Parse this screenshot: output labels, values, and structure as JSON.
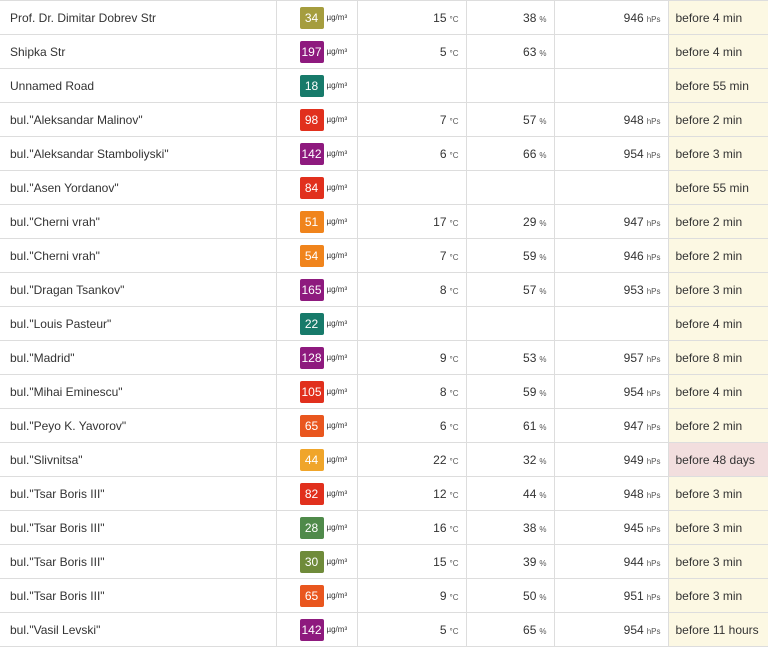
{
  "table": {
    "rows": [
      {
        "location": "Prof. Dr. Dimitar Dobrev Str",
        "aqi": "34",
        "color": "#a59d3e",
        "pm_unit": "µg/m³",
        "temp": "15",
        "temp_unit": "°C",
        "humidity": "38",
        "humidity_unit": "%",
        "pressure": "946",
        "pressure_unit": "hPs",
        "updated": "before 4 min",
        "stale": false
      },
      {
        "location": "Shipka Str",
        "aqi": "197",
        "color": "#8e1a7e",
        "pm_unit": "µg/m³",
        "temp": "5",
        "temp_unit": "°C",
        "humidity": "63",
        "humidity_unit": "%",
        "pressure": "",
        "pressure_unit": "",
        "updated": "before 4 min",
        "stale": false
      },
      {
        "location": "Unnamed Road",
        "aqi": "18",
        "color": "#177a6a",
        "pm_unit": "µg/m³",
        "temp": "",
        "temp_unit": "",
        "humidity": "",
        "humidity_unit": "",
        "pressure": "",
        "pressure_unit": "",
        "updated": "before 55 min",
        "stale": false
      },
      {
        "location": "bul.\"Aleksandar Malinov\"",
        "aqi": "98",
        "color": "#e1301d",
        "pm_unit": "µg/m³",
        "temp": "7",
        "temp_unit": "°C",
        "humidity": "57",
        "humidity_unit": "%",
        "pressure": "948",
        "pressure_unit": "hPs",
        "updated": "before 2 min",
        "stale": false
      },
      {
        "location": "bul.\"Aleksandar Stamboliyski\"",
        "aqi": "142",
        "color": "#8e1a7e",
        "pm_unit": "µg/m³",
        "temp": "6",
        "temp_unit": "°C",
        "humidity": "66",
        "humidity_unit": "%",
        "pressure": "954",
        "pressure_unit": "hPs",
        "updated": "before 3 min",
        "stale": false
      },
      {
        "location": "bul.\"Asen Yordanov\"",
        "aqi": "84",
        "color": "#e1301d",
        "pm_unit": "µg/m³",
        "temp": "",
        "temp_unit": "",
        "humidity": "",
        "humidity_unit": "",
        "pressure": "",
        "pressure_unit": "",
        "updated": "before 55 min",
        "stale": false
      },
      {
        "location": "bul.\"Cherni vrah\"",
        "aqi": "51",
        "color": "#f0841c",
        "pm_unit": "µg/m³",
        "temp": "17",
        "temp_unit": "°C",
        "humidity": "29",
        "humidity_unit": "%",
        "pressure": "947",
        "pressure_unit": "hPs",
        "updated": "before 2 min",
        "stale": false
      },
      {
        "location": "bul.\"Cherni vrah\"",
        "aqi": "54",
        "color": "#f0841c",
        "pm_unit": "µg/m³",
        "temp": "7",
        "temp_unit": "°C",
        "humidity": "59",
        "humidity_unit": "%",
        "pressure": "946",
        "pressure_unit": "hPs",
        "updated": "before 2 min",
        "stale": false
      },
      {
        "location": "bul.\"Dragan Tsankov\"",
        "aqi": "165",
        "color": "#8e1a7e",
        "pm_unit": "µg/m³",
        "temp": "8",
        "temp_unit": "°C",
        "humidity": "57",
        "humidity_unit": "%",
        "pressure": "953",
        "pressure_unit": "hPs",
        "updated": "before 3 min",
        "stale": false
      },
      {
        "location": "bul.\"Louis Pasteur\"",
        "aqi": "22",
        "color": "#177a6a",
        "pm_unit": "µg/m³",
        "temp": "",
        "temp_unit": "",
        "humidity": "",
        "humidity_unit": "",
        "pressure": "",
        "pressure_unit": "",
        "updated": "before 4 min",
        "stale": false
      },
      {
        "location": "bul.\"Madrid\"",
        "aqi": "128",
        "color": "#8e1a7e",
        "pm_unit": "µg/m³",
        "temp": "9",
        "temp_unit": "°C",
        "humidity": "53",
        "humidity_unit": "%",
        "pressure": "957",
        "pressure_unit": "hPs",
        "updated": "before 8 min",
        "stale": false
      },
      {
        "location": "bul.\"Mihai Eminescu\"",
        "aqi": "105",
        "color": "#e1301d",
        "pm_unit": "µg/m³",
        "temp": "8",
        "temp_unit": "°C",
        "humidity": "59",
        "humidity_unit": "%",
        "pressure": "954",
        "pressure_unit": "hPs",
        "updated": "before 4 min",
        "stale": false
      },
      {
        "location": "bul.\"Peyo K. Yavorov\"",
        "aqi": "65",
        "color": "#e9561e",
        "pm_unit": "µg/m³",
        "temp": "6",
        "temp_unit": "°C",
        "humidity": "61",
        "humidity_unit": "%",
        "pressure": "947",
        "pressure_unit": "hPs",
        "updated": "before 2 min",
        "stale": false
      },
      {
        "location": "bul.\"Slivnitsa\"",
        "aqi": "44",
        "color": "#f0a52a",
        "pm_unit": "µg/m³",
        "temp": "22",
        "temp_unit": "°C",
        "humidity": "32",
        "humidity_unit": "%",
        "pressure": "949",
        "pressure_unit": "hPs",
        "updated": "before 48 days",
        "stale": true
      },
      {
        "location": "bul.\"Tsar Boris III\"",
        "aqi": "82",
        "color": "#e1301d",
        "pm_unit": "µg/m³",
        "temp": "12",
        "temp_unit": "°C",
        "humidity": "44",
        "humidity_unit": "%",
        "pressure": "948",
        "pressure_unit": "hPs",
        "updated": "before 3 min",
        "stale": false
      },
      {
        "location": "bul.\"Tsar Boris III\"",
        "aqi": "28",
        "color": "#4f8a4a",
        "pm_unit": "µg/m³",
        "temp": "16",
        "temp_unit": "°C",
        "humidity": "38",
        "humidity_unit": "%",
        "pressure": "945",
        "pressure_unit": "hPs",
        "updated": "before 3 min",
        "stale": false
      },
      {
        "location": "bul.\"Tsar Boris III\"",
        "aqi": "30",
        "color": "#6f8b3a",
        "pm_unit": "µg/m³",
        "temp": "15",
        "temp_unit": "°C",
        "humidity": "39",
        "humidity_unit": "%",
        "pressure": "944",
        "pressure_unit": "hPs",
        "updated": "before 3 min",
        "stale": false
      },
      {
        "location": "bul.\"Tsar Boris III\"",
        "aqi": "65",
        "color": "#e9561e",
        "pm_unit": "µg/m³",
        "temp": "9",
        "temp_unit": "°C",
        "humidity": "50",
        "humidity_unit": "%",
        "pressure": "951",
        "pressure_unit": "hPs",
        "updated": "before 3 min",
        "stale": false
      },
      {
        "location": "bul.\"Vasil Levski\"",
        "aqi": "142",
        "color": "#8e1a7e",
        "pm_unit": "µg/m³",
        "temp": "5",
        "temp_unit": "°C",
        "humidity": "65",
        "humidity_unit": "%",
        "pressure": "954",
        "pressure_unit": "hPs",
        "updated": "before 11 hours",
        "stale": false
      }
    ]
  }
}
